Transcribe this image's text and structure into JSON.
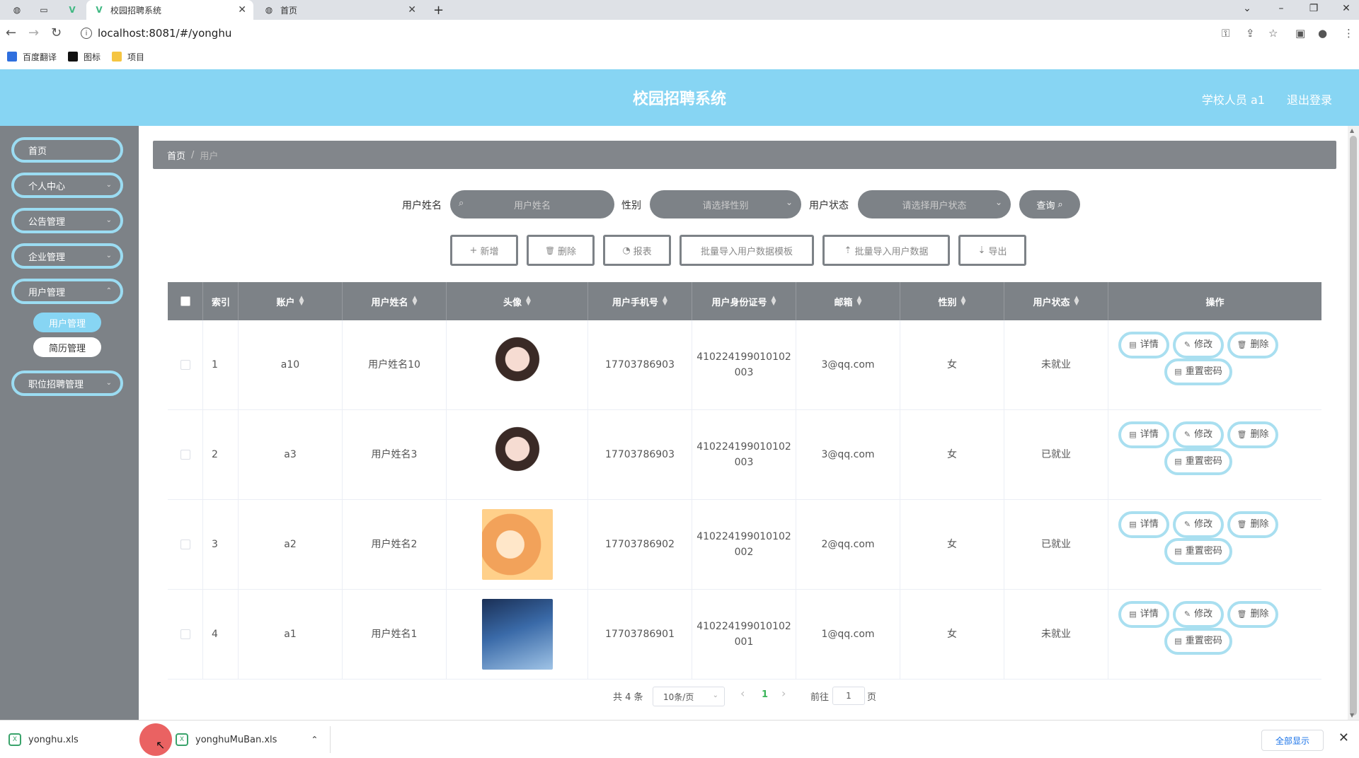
{
  "browser": {
    "tabs": [
      {
        "title": "校园招聘系统"
      },
      {
        "title": "首页"
      }
    ],
    "url": "localhost:8081/#/yonghu",
    "bookmarks": [
      {
        "label": "百度翻译"
      },
      {
        "label": "图标"
      },
      {
        "label": "项目"
      }
    ]
  },
  "header": {
    "title": "校园招聘系统",
    "user": "学校人员 a1",
    "logout": "退出登录"
  },
  "sidebar": {
    "items": [
      {
        "label": "首页"
      },
      {
        "label": "个人中心"
      },
      {
        "label": "公告管理"
      },
      {
        "label": "企业管理"
      },
      {
        "label": "用户管理"
      },
      {
        "label": "职位招聘管理"
      }
    ],
    "subitems": [
      {
        "label": "用户管理",
        "active": true
      },
      {
        "label": "简历管理",
        "active": false
      }
    ]
  },
  "breadcrumb": {
    "home": "首页",
    "sep": "/",
    "current": "用户"
  },
  "filters": {
    "name_label": "用户姓名",
    "name_placeholder": "用户姓名",
    "gender_label": "性别",
    "gender_placeholder": "请选择性别",
    "status_label": "用户状态",
    "status_placeholder": "请选择用户状态",
    "query": "查询"
  },
  "toolbar": {
    "add": "新增",
    "delete": "删除",
    "report": "报表",
    "template": "批量导入用户数据模板",
    "import": "批量导入用户数据",
    "export": "导出"
  },
  "table": {
    "headers": {
      "index": "索引",
      "account": "账户",
      "name": "用户姓名",
      "avatar": "头像",
      "phone": "用户手机号",
      "idcard": "用户身份证号",
      "email": "邮箱",
      "gender": "性别",
      "status": "用户状态",
      "ops": "操作"
    },
    "rows": [
      {
        "index": "1",
        "account": "a10",
        "name": "用户姓名10",
        "phone": "17703786903",
        "id1": "410224199010102",
        "id2": "003",
        "email": "3@qq.com",
        "gender": "女",
        "status": "未就业"
      },
      {
        "index": "2",
        "account": "a3",
        "name": "用户姓名3",
        "phone": "17703786903",
        "id1": "410224199010102",
        "id2": "003",
        "email": "3@qq.com",
        "gender": "女",
        "status": "已就业"
      },
      {
        "index": "3",
        "account": "a2",
        "name": "用户姓名2",
        "phone": "17703786902",
        "id1": "410224199010102",
        "id2": "002",
        "email": "2@qq.com",
        "gender": "女",
        "status": "已就业"
      },
      {
        "index": "4",
        "account": "a1",
        "name": "用户姓名1",
        "phone": "17703786901",
        "id1": "410224199010102",
        "id2": "001",
        "email": "1@qq.com",
        "gender": "女",
        "status": "未就业"
      }
    ],
    "actions": {
      "detail": "详情",
      "edit": "修改",
      "delete": "删除",
      "reset": "重置密码"
    }
  },
  "pagination": {
    "total": "共 4 条",
    "page_size": "10条/页",
    "prev": "‹",
    "current": "1",
    "next": "›",
    "goto_label": "前往",
    "goto_value": "1",
    "goto_suffix": "页"
  },
  "downloads": {
    "files": [
      {
        "name": "yonghu.xls"
      },
      {
        "name": "yonghuMuBan.xls"
      }
    ],
    "show_all": "全部显示"
  }
}
